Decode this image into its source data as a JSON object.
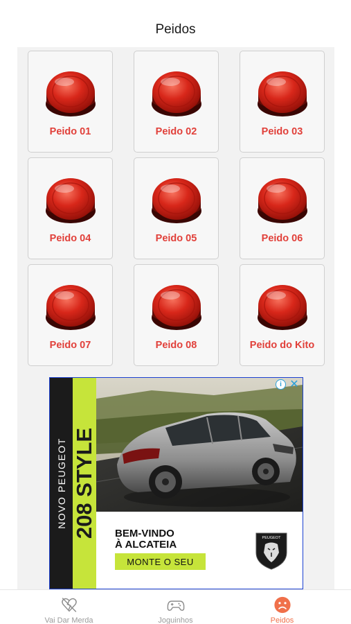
{
  "header": {
    "title": "Peidos"
  },
  "sounds": [
    {
      "label": "Peido 01"
    },
    {
      "label": "Peido 02"
    },
    {
      "label": "Peido 03"
    },
    {
      "label": "Peido 04"
    },
    {
      "label": "Peido 05"
    },
    {
      "label": "Peido 06"
    },
    {
      "label": "Peido 07"
    },
    {
      "label": "Peido 08"
    },
    {
      "label": "Peido do Kito"
    }
  ],
  "ad": {
    "side_small": "NOVO PEUGEOT",
    "side_big": "208 STYLE",
    "welcome_line1": "BEM-VINDO",
    "welcome_line2": "À ALCATEIA",
    "cta": "MONTE O SEU",
    "logo_text": "PEUGEOT",
    "info_glyph": "i",
    "close_glyph": "✕"
  },
  "tabbar": {
    "tabs": [
      {
        "label": "Vai Dar Merda",
        "icon": "broken-heart-icon"
      },
      {
        "label": "Joguinhos",
        "icon": "gamepad-icon"
      },
      {
        "label": "Peidos",
        "icon": "sad-face-icon",
        "active": true
      }
    ]
  },
  "colors": {
    "accent": "#e1403a",
    "ad_lime": "#c6e43a",
    "tab_active": "#f0704a"
  }
}
